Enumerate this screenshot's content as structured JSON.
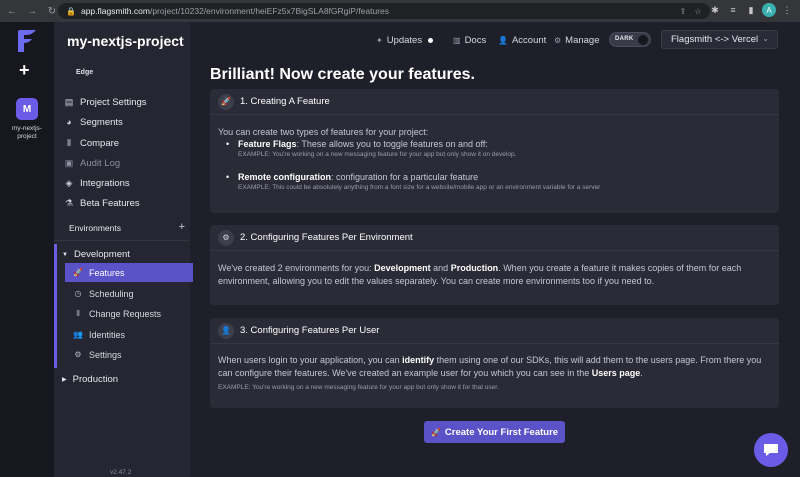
{
  "browser": {
    "url_host": "app.flagsmith.com",
    "url_path": "/project/10232/environment/heiEFz5x7BigSLA8fGRgiP/features",
    "profile_initial": "A"
  },
  "rail": {
    "add_label": "+",
    "project_initial": "M",
    "project_name": "my-nextjs-project"
  },
  "sidebar": {
    "project_title": "my-nextjs-project",
    "badge": "Edge",
    "items": [
      {
        "label": "Project Settings",
        "icon": "settings-icon"
      },
      {
        "label": "Segments",
        "icon": "pie-icon"
      },
      {
        "label": "Compare",
        "icon": "compare-icon"
      },
      {
        "label": "Audit Log",
        "icon": "list-icon"
      },
      {
        "label": "Integrations",
        "icon": "layers-icon"
      },
      {
        "label": "Beta Features",
        "icon": "flask-icon"
      }
    ],
    "environments_label": "Environments",
    "environments_add": "+",
    "env_development": "Development",
    "env_items": [
      {
        "label": "Features",
        "icon": "rocket-icon"
      },
      {
        "label": "Scheduling",
        "icon": "clock-icon"
      },
      {
        "label": "Change Requests",
        "icon": "compare-icon"
      },
      {
        "label": "Identities",
        "icon": "users-icon"
      },
      {
        "label": "Settings",
        "icon": "cogs-icon"
      }
    ],
    "env_production": "Production",
    "version": "v2.47.2"
  },
  "topnav": {
    "updates": "Updates",
    "docs": "Docs",
    "account": "Account",
    "manage": "Manage",
    "theme": "DARK",
    "project_select": "Flagsmith <-> Vercel"
  },
  "main": {
    "title": "Brilliant! Now create your features.",
    "card1": {
      "title": "1. Creating A Feature",
      "intro": "You can create two types of features for your project:",
      "b1_strong": "Feature Flags",
      "b1_text": ": These allows you to toggle features on and off:",
      "b1_example": "EXAMPLE: You're working on a new messaging feature for your app but only show it on develop.",
      "b2_strong": "Remote configuration",
      "b2_text": ": configuration for a particular feature",
      "b2_example": "EXAMPLE: This could be absolutely anything from a font size for a website/mobile app or an environment variable for a server"
    },
    "card2": {
      "title": "2. Configuring Features Per Environment",
      "t1": "We've created 2 environments for you: ",
      "s1": "Development",
      "t2": " and ",
      "s2": "Production",
      "t3": ". When you create a feature it makes copies of them for each environment, allowing you to edit the values separately. You can create more environments too if you need to."
    },
    "card3": {
      "title": "3. Configuring Features Per User",
      "t1": "When users login to your application, you can ",
      "s1": "identify",
      "t2": " them using one of our SDKs, this will add them to the users page. From there you can configure their features. We've created an example user for you which you can see in the ",
      "s2": "Users page",
      "t3": ".",
      "example": "EXAMPLE: You're working on a new messaging feature for your app but only show it for that user."
    },
    "cta": "Create Your First Feature"
  }
}
